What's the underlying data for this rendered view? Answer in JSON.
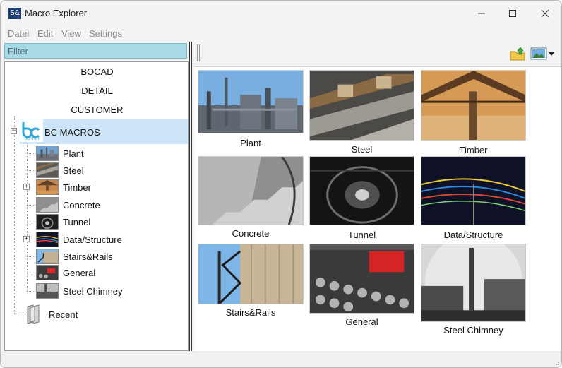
{
  "window": {
    "app_icon_text": "S&",
    "title": "Macro Explorer"
  },
  "menu": [
    "Datei",
    "Edit",
    "View",
    "Settings"
  ],
  "filter": {
    "placeholder": "Filter",
    "value": ""
  },
  "tree": {
    "categories": [
      "BOCAD",
      "DETAIL",
      "CUSTOMER"
    ],
    "root": {
      "label": "BC MACROS",
      "logo_text": "buhren",
      "logo_subtext": "consulting",
      "children": [
        {
          "label": "Plant",
          "expandable": false
        },
        {
          "label": "Steel",
          "expandable": false
        },
        {
          "label": "Timber",
          "expandable": true
        },
        {
          "label": "Concrete",
          "expandable": false
        },
        {
          "label": "Tunnel",
          "expandable": false
        },
        {
          "label": "Data/Structure",
          "expandable": true
        },
        {
          "label": "Stairs&Rails",
          "expandable": false
        },
        {
          "label": "General",
          "expandable": false
        },
        {
          "label": "Steel Chimney",
          "expandable": false
        }
      ]
    },
    "recent_label": "Recent",
    "expand_glyph": "+",
    "collapse_glyph": "−"
  },
  "toolbar": {
    "icons": [
      "folder-up-icon",
      "image-view-icon",
      "dropdown-arrow-icon"
    ]
  },
  "gallery": [
    {
      "label": "Plant",
      "icon": "plant-photo"
    },
    {
      "label": "Steel",
      "icon": "steel-photo"
    },
    {
      "label": "Timber",
      "icon": "timber-photo"
    },
    {
      "label": "Concrete",
      "icon": "concrete-photo"
    },
    {
      "label": "Tunnel",
      "icon": "tunnel-photo"
    },
    {
      "label": "Data/Structure",
      "icon": "data-structure-photo"
    },
    {
      "label": "Stairs&Rails",
      "icon": "stairs-rails-photo"
    },
    {
      "label": "General",
      "icon": "general-photo"
    },
    {
      "label": "Steel Chimney",
      "icon": "steel-chimney-photo"
    }
  ],
  "colors": {
    "filter_bg": "#a9d9e4",
    "selection_bg": "#cce4f7",
    "app_icon_bg": "#1f3f78",
    "menu_text": "#8c8c8c"
  }
}
